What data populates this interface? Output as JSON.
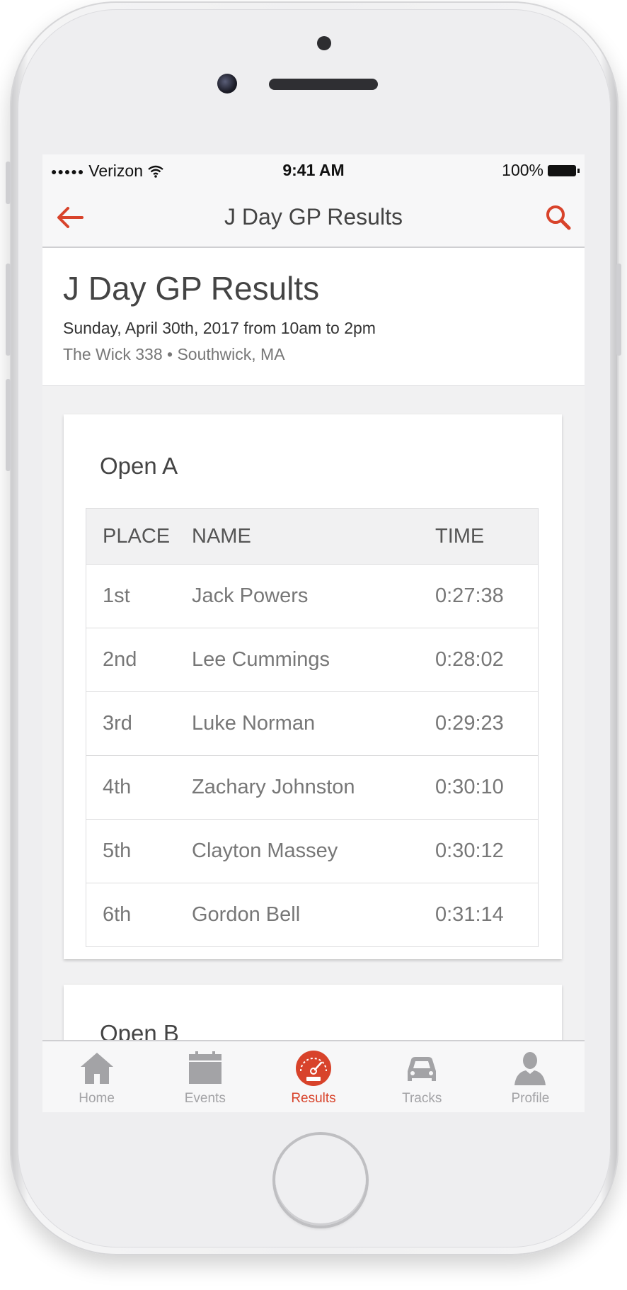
{
  "status_bar": {
    "signal": "●●●●●",
    "carrier": "Verizon",
    "time": "9:41 AM",
    "battery": "100%"
  },
  "nav": {
    "title": "J Day GP Results",
    "back_icon": "arrow-left-icon",
    "search_icon": "search-icon"
  },
  "event": {
    "title": "J Day GP Results",
    "date": "Sunday, April 30th, 2017 from 10am to 2pm",
    "venue": "The Wick 338 • Southwick, MA"
  },
  "classes": [
    {
      "title": "Open A",
      "columns": [
        "PLACE",
        "NAME",
        "TIME"
      ],
      "rows": [
        {
          "place": "1st",
          "name": "Jack Powers",
          "time": "0:27:38"
        },
        {
          "place": "2nd",
          "name": "Lee Cummings",
          "time": "0:28:02"
        },
        {
          "place": "3rd",
          "name": "Luke Norman",
          "time": "0:29:23"
        },
        {
          "place": "4th",
          "name": "Zachary Johnston",
          "time": "0:30:10"
        },
        {
          "place": "5th",
          "name": "Clayton Massey",
          "time": "0:30:12"
        },
        {
          "place": "6th",
          "name": "Gordon Bell",
          "time": "0:31:14"
        }
      ]
    },
    {
      "title": "Open B"
    }
  ],
  "tabs": [
    {
      "label": "Home",
      "icon": "home-icon"
    },
    {
      "label": "Events",
      "icon": "calendar-icon"
    },
    {
      "label": "Results",
      "icon": "speedometer-icon",
      "active": true
    },
    {
      "label": "Tracks",
      "icon": "car-icon"
    },
    {
      "label": "Profile",
      "icon": "person-icon"
    }
  ],
  "colors": {
    "accent": "#d8432b",
    "inactive_tab": "#a3a3a6",
    "text_dark": "#444444",
    "text_muted": "#777777"
  }
}
